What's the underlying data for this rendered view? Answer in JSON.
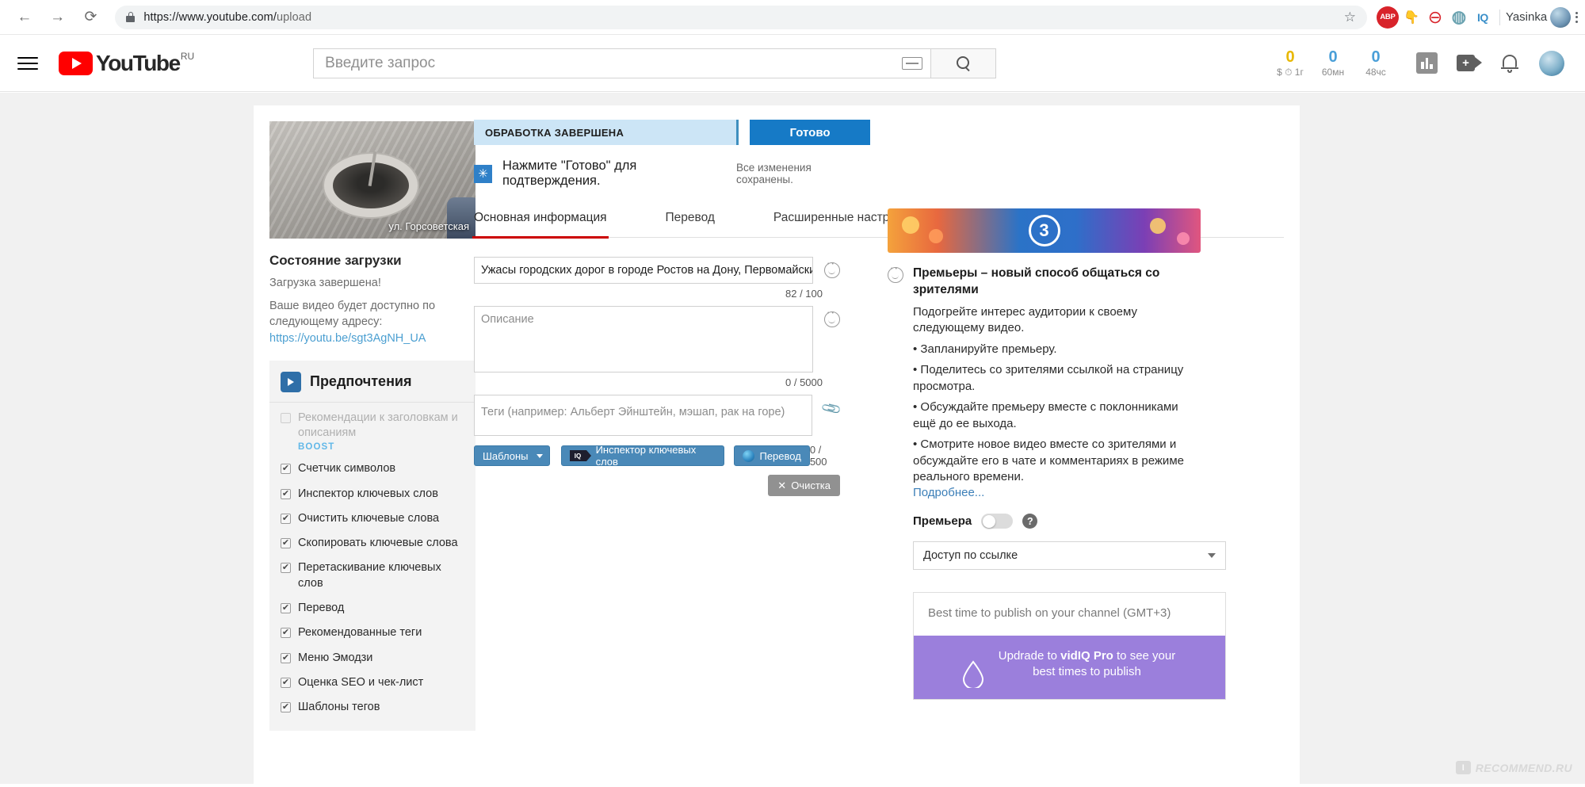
{
  "browser": {
    "back_icon": "←",
    "forward_icon": "→",
    "reload_icon": "⟳",
    "url_main": "https://www.youtube.com/",
    "url_path": "upload",
    "star_icon": "☆",
    "extensions": [
      {
        "name": "adblock-plus",
        "label": "ABP"
      },
      {
        "name": "download-hand",
        "label": "👇"
      },
      {
        "name": "ghostery",
        "label": "⊖"
      },
      {
        "name": "water-drop",
        "label": "◍"
      },
      {
        "name": "vidiq",
        "label": "IQ"
      }
    ],
    "profile_name": "Yasinka"
  },
  "youtube_header": {
    "logo_text": "YouTube",
    "logo_country": "RU",
    "search_placeholder": "Введите запрос",
    "vidiq_stats": [
      {
        "value": "0",
        "label": "$ ⏱ 1г",
        "color": "#e8b800"
      },
      {
        "value": "0",
        "label": "60мн",
        "color": "#4a9fd8"
      },
      {
        "value": "0",
        "label": "48чс",
        "color": "#4a9fd8"
      }
    ],
    "icons": [
      "analytics-icon",
      "video-camera-icon",
      "notifications-bell-icon",
      "account-avatar"
    ]
  },
  "left_panel": {
    "thumbnail_caption": "ул. Горсоветская",
    "upload_status_title": "Состояние загрузки",
    "upload_status_line": "Загрузка завершена!",
    "upload_address_note": "Ваше видео будет доступно по следующему адресу:",
    "video_url": "https://youtu.be/sgt3AgNH_UA",
    "preferences_title": "Предпочтения",
    "preferences": [
      {
        "label": "Рекомендации к заголовкам и описаниям",
        "checked": false,
        "badge": "BOOST"
      },
      {
        "label": "Счетчик символов",
        "checked": true
      },
      {
        "label": "Инспектор ключевых слов",
        "checked": true
      },
      {
        "label": "Очистить ключевые слова",
        "checked": true
      },
      {
        "label": "Скопировать ключевые слова",
        "checked": true
      },
      {
        "label": "Перетаскивание ключевых слов",
        "checked": true
      },
      {
        "label": "Перевод",
        "checked": true
      },
      {
        "label": "Рекомендованные теги",
        "checked": true
      },
      {
        "label": "Меню Эмодзи",
        "checked": true
      },
      {
        "label": "Оценка SEO и чек-лист",
        "checked": true
      },
      {
        "label": "Шаблоны тегов",
        "checked": true
      }
    ]
  },
  "main": {
    "status_label": "ОБРАБОТКА ЗАВЕРШЕНА",
    "done_button": "Готово",
    "hint_text": "Нажмите \"Готово\" для подтверждения.",
    "hint_badge_icon": "✳",
    "saved_text": "Все изменения сохранены.",
    "tabs": [
      {
        "label": "Основная информация",
        "active": true
      },
      {
        "label": "Перевод",
        "active": false
      },
      {
        "label": "Расширенные настройки",
        "active": false
      }
    ],
    "title_value": "Ужасы городских дорог в городе Ростов на Дону, Первомайский",
    "title_counter": "82 / 100",
    "description_placeholder": "Описание",
    "description_counter": "0 / 5000",
    "tags_placeholder": "Теги (например: Альберт Эйнштейн, мэшап, рак на горе)",
    "tags_counter": "0 / 500",
    "templates_button": "Шаблоны",
    "keyword_inspector_button": "Инспектор ключевых слов",
    "translate_button": "Перевод",
    "clear_button": "Очистка",
    "clear_icon": "✕"
  },
  "right_panel": {
    "banner_number": "3",
    "promo_title": "Премьеры – новый способ общаться со зрителями",
    "promo_subtitle": "Подогрейте интерес аудитории к своему следующему видео.",
    "promo_bullets": [
      "• Запланируйте премьеру.",
      "• Поделитесь со зрителями ссылкой на страницу просмотра.",
      "• Обсуждайте премьеру вместе с поклонниками ещё до ее выхода.",
      "• Смотрите новое видео вместе со зрителями и обсуждайте его в чате и комментариях в режиме реального времени."
    ],
    "promo_more": "Подробнее...",
    "premiere_label": "Премьера",
    "premiere_enabled": false,
    "help_icon": "?",
    "privacy_value": "Доступ по ссылке",
    "best_time_title": "Best time to publish on your channel (GMT+3)",
    "upgrade_text_1": "Updrade to ",
    "upgrade_brand": "vidIQ Pro",
    "upgrade_text_2": " to see your best times to publish"
  },
  "watermark": {
    "badge": "I",
    "text": "RECOMMEND.RU"
  }
}
